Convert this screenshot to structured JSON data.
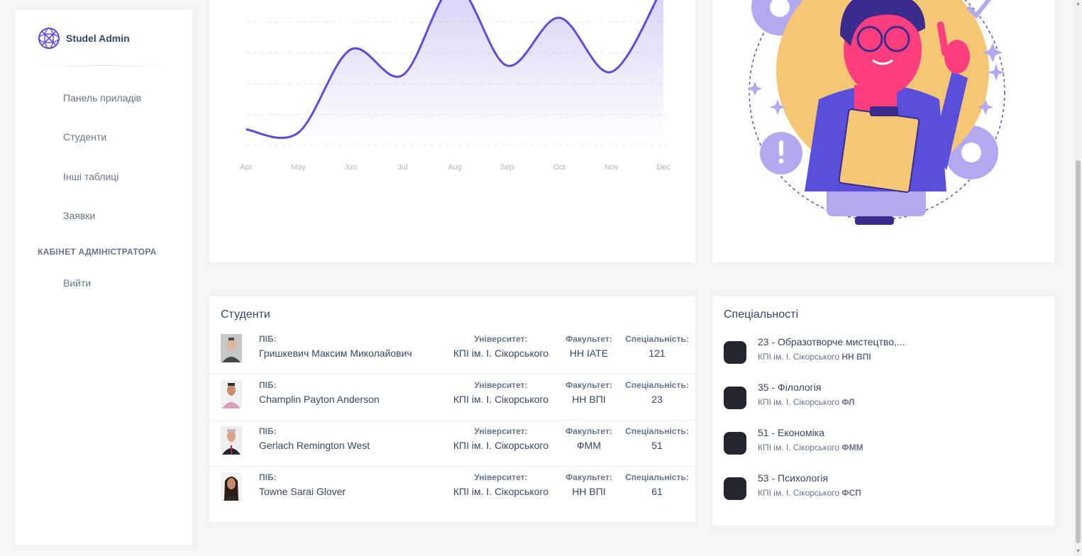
{
  "brand": {
    "name": "Studel Admin"
  },
  "sidebar": {
    "items": [
      {
        "label": "Панель приладів"
      },
      {
        "label": "Студенти"
      },
      {
        "label": "Інші таблиці"
      },
      {
        "label": "Заявки"
      }
    ],
    "section_title": "КАБІНЕТ АДМІНІСТРАТОРА",
    "logout_label": "Вийти"
  },
  "chart_data": {
    "type": "area",
    "x": [
      "Apr",
      "May",
      "Jun",
      "Jul",
      "Aug",
      "Sep",
      "Oct",
      "Nov",
      "Dec"
    ],
    "series": [
      {
        "values": [
          50,
          40,
          300,
          220,
          500,
          250,
          400,
          230,
          500
        ]
      }
    ],
    "ylim": [
      0,
      500
    ],
    "grid": true,
    "color": "#5e4bdb"
  },
  "students": {
    "title": "Студенти",
    "labels": {
      "name": "ПІБ:",
      "university": "Університет:",
      "faculty": "Факультет:",
      "specialty": "Спеціальність:"
    },
    "rows": [
      {
        "name": "Гришкевич Максим Миколайович",
        "university": "КПІ ім. І. Сікорського",
        "faculty": "НН ІАТЕ",
        "specialty": "121"
      },
      {
        "name": "Champlin Payton Anderson",
        "university": "КПІ ім. І. Сікорського",
        "faculty": "НН ВПІ",
        "specialty": "23"
      },
      {
        "name": "Gerlach Remington West",
        "university": "КПІ ім. І. Сікорського",
        "faculty": "ФММ",
        "specialty": "51"
      },
      {
        "name": "Towne Sarai Glover",
        "university": "КПІ ім. І. Сікорського",
        "faculty": "НН ВПІ",
        "specialty": "61"
      }
    ]
  },
  "specialties": {
    "title": "Спеціальності",
    "items": [
      {
        "title": "23 - Образотворче мистецтво,...",
        "university": "КПІ ім. І. Сікорського",
        "faculty": "НН ВПІ"
      },
      {
        "title": "35 - Філологія",
        "university": "КПІ ім. І. Сікорського",
        "faculty": "ФЛ"
      },
      {
        "title": "51 - Економіка",
        "university": "КПІ ім. І. Сікорського",
        "faculty": "ФММ"
      },
      {
        "title": "53 - Психологія",
        "university": "КПІ ім. І. Сікорського",
        "faculty": "ФСП"
      }
    ]
  }
}
